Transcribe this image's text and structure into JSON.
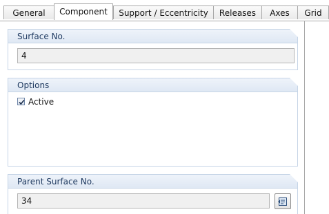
{
  "tabs": [
    {
      "label": "General",
      "active": false
    },
    {
      "label": "Component",
      "active": true
    },
    {
      "label": "Support / Eccentricity",
      "active": false
    },
    {
      "label": "Releases",
      "active": false
    },
    {
      "label": "Axes",
      "active": false
    },
    {
      "label": "Grid",
      "active": false
    }
  ],
  "surface_no": {
    "title": "Surface No.",
    "value": "4"
  },
  "options": {
    "title": "Options",
    "active_label": "Active",
    "active_checked": true
  },
  "parent_surface_no": {
    "title": "Parent Surface No.",
    "value": "34",
    "pick_icon": "select-from-graphic-icon"
  },
  "colors": {
    "group_header": "#dfe8f4",
    "group_border": "#c5d4e6",
    "field_background": "#f0f0f0",
    "title_text": "#1f3a60"
  }
}
